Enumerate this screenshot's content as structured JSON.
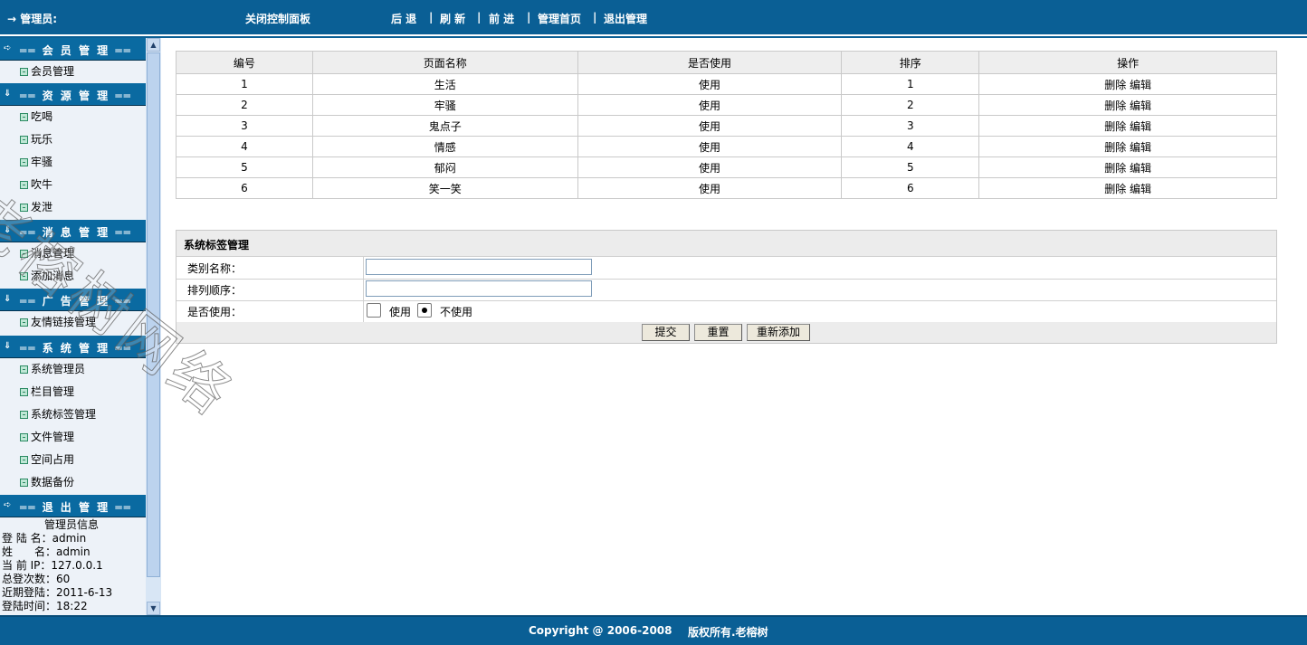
{
  "topbar": {
    "admin_label": "→ 管理员:",
    "close_panel": "关闭控制面板",
    "back": "后 退",
    "refresh": "刷 新",
    "forward": "前 进",
    "home": "管理首页",
    "logout": "退出管理",
    "separator": "|"
  },
  "sidebar": {
    "sections": [
      {
        "title": "══ 会 员 管 理 ══",
        "items": [
          "会员管理"
        ]
      },
      {
        "title": "══ 资 源 管 理 ══",
        "items": [
          "吃喝",
          "玩乐",
          "牢骚",
          "吹牛",
          "发泄"
        ]
      },
      {
        "title": "══ 消 息 管 理 ══",
        "items": [
          "消息管理",
          "添加消息"
        ]
      },
      {
        "title": "══ 广 告 管 理 ══",
        "items": [
          "友情链接管理"
        ]
      },
      {
        "title": "══ 系 统 管 理 ══",
        "items": [
          "系统管理员",
          "栏目管理",
          "系统标签管理",
          "文件管理",
          "空间占用",
          "数据备份"
        ]
      },
      {
        "title": "══ 退 出 管 理 ══",
        "items": []
      }
    ],
    "admin_info": {
      "title": "管理员信息",
      "lines": [
        "登 陆 名：admin",
        "姓　　名：admin",
        "当 前 IP：127.0.0.1",
        "总登次数：60",
        "近期登陆：2011-6-13",
        "登陆时间：18:22"
      ]
    }
  },
  "table": {
    "headers": [
      "编号",
      "页面名称",
      "是否使用",
      "排序",
      "操作"
    ],
    "rows": [
      {
        "id": "1",
        "name": "生活",
        "use": "使用",
        "order": "1"
      },
      {
        "id": "2",
        "name": "牢骚",
        "use": "使用",
        "order": "2"
      },
      {
        "id": "3",
        "name": "鬼点子",
        "use": "使用",
        "order": "3"
      },
      {
        "id": "4",
        "name": "情感",
        "use": "使用",
        "order": "4"
      },
      {
        "id": "5",
        "name": "郁闷",
        "use": "使用",
        "order": "5"
      },
      {
        "id": "6",
        "name": "笑一笑",
        "use": "使用",
        "order": "6"
      }
    ],
    "delete_label": "删除",
    "edit_label": "编辑"
  },
  "form": {
    "title": "系统标签管理",
    "category_label": "类别名称：",
    "category_value": "",
    "order_label": "排列顺序：",
    "order_value": "",
    "use_label": "是否使用：",
    "option_use": "使用",
    "option_not_use": "不使用",
    "selected": "不使用",
    "submit": "提交",
    "reset": "重置",
    "readd": "重新添加"
  },
  "footer": {
    "copyright": "Copyright @ 2006-2008",
    "rights": "版权所有.老榕树"
  },
  "watermark": "老榕树网络",
  "colors": {
    "header_blue": "#0a5f95",
    "section_blue": "#0a6aa1",
    "sidebar_bg": "#edf2f8",
    "table_header_bg": "#eeeeee"
  }
}
